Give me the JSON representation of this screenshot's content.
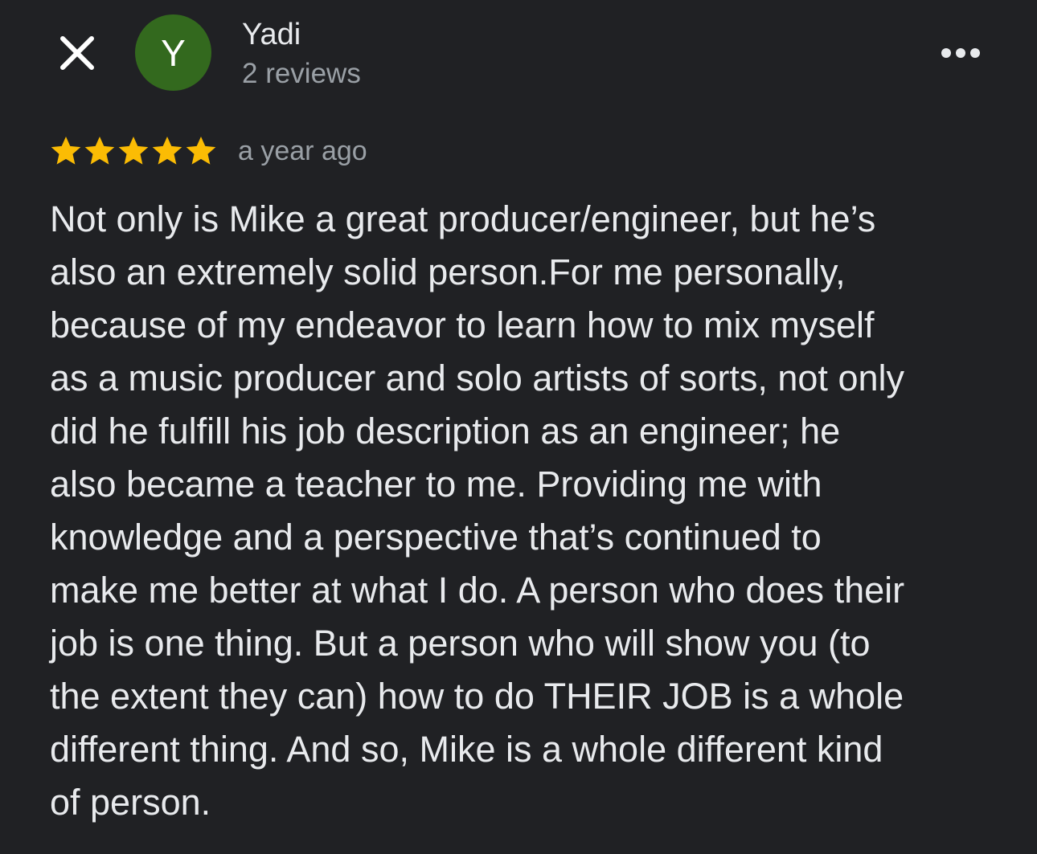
{
  "header": {
    "close_icon": "close-icon",
    "avatar_letter": "Y",
    "avatar_color": "#33691e",
    "reviewer_name": "Yadi",
    "review_count": "2 reviews",
    "more_icon": "more-horizontal-icon"
  },
  "review": {
    "rating": 5,
    "rating_max": 5,
    "star_color": "#fbbc04",
    "date": "a year ago",
    "lines": [
      "Not only is Mike a great producer/engineer, but he’s",
      "also an extremely solid person.For me personally,",
      "because of my endeavor to learn how to mix myself",
      "as a music producer and solo artists of sorts, not only",
      "did he fulfill his job description as an engineer; he",
      "also became a teacher to me. Providing me with",
      "knowledge and a perspective that’s continued to",
      "make me better at what I do. A person who does their",
      "job is one thing. But a person who will show you (to",
      "the extent they can) how to do THEIR JOB is a whole",
      "different thing. And so, Mike is a whole different kind",
      "of person."
    ]
  },
  "colors": {
    "background": "#202124",
    "text_primary": "#e8eaed",
    "text_secondary": "#9aa0a6"
  }
}
